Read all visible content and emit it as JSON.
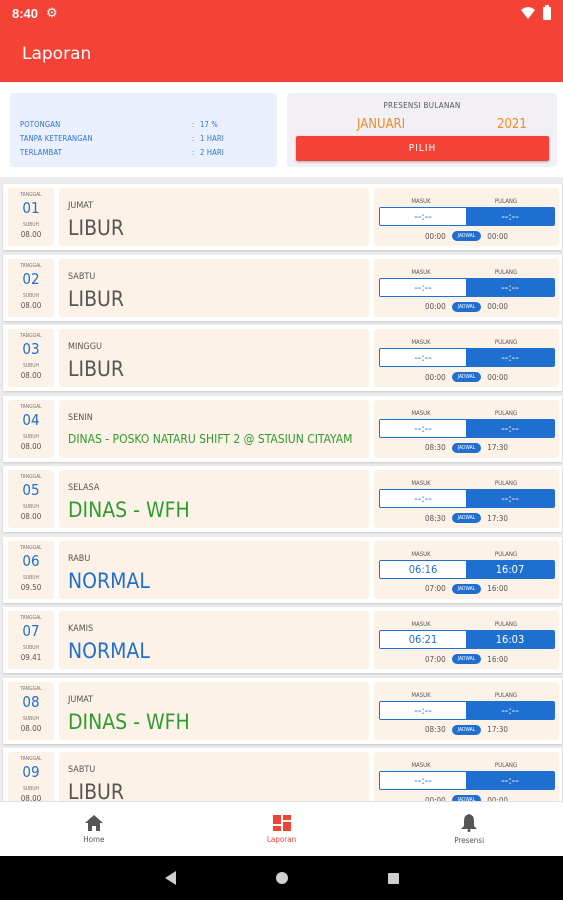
{
  "status_bar": {
    "time": "8:40"
  },
  "app_bar": {
    "title": "Laporan"
  },
  "summary": {
    "items": [
      {
        "label": "POTONGAN",
        "value": "17 %"
      },
      {
        "label": "TANPA KETERANGAN",
        "value": "1 HARI"
      },
      {
        "label": "TERLAMBAT",
        "value": "2 HARI"
      }
    ]
  },
  "period": {
    "title": "PRESENSI BULANAN",
    "month": "JANUARI",
    "year": "2021",
    "button_label": "PILIH"
  },
  "row_labels": {
    "tanggal": "TANGGAL",
    "sebelum": "SUBUH",
    "masuk": "MASUK",
    "pulang": "PULANG",
    "jadwal": "JADWAL"
  },
  "days": [
    {
      "date": "01",
      "subuh": "08.00",
      "day": "JUMAT",
      "status": "LIBUR",
      "status_color": "#555555",
      "in": "--:--",
      "out": "--:--",
      "sched_in": "00:00",
      "sched_out": "00:00"
    },
    {
      "date": "02",
      "subuh": "08.00",
      "day": "SABTU",
      "status": "LIBUR",
      "status_color": "#555555",
      "in": "--:--",
      "out": "--:--",
      "sched_in": "00:00",
      "sched_out": "00:00"
    },
    {
      "date": "03",
      "subuh": "08.00",
      "day": "MINGGU",
      "status": "LIBUR",
      "status_color": "#555555",
      "in": "--:--",
      "out": "--:--",
      "sched_in": "00:00",
      "sched_out": "00:00"
    },
    {
      "date": "04",
      "subuh": "08.00",
      "day": "SENIN",
      "status": "DINAS - POSKO NATARU SHIFT 2 @ STASIUN CITAYAM",
      "status_color": "#2e9c2e",
      "in": "--:--",
      "out": "--:--",
      "sched_in": "08:30",
      "sched_out": "17:30"
    },
    {
      "date": "05",
      "subuh": "08.00",
      "day": "SELASA",
      "status": "DINAS - WFH",
      "status_color": "#2e9c2e",
      "in": "--:--",
      "out": "--:--",
      "sched_in": "08:30",
      "sched_out": "17:30"
    },
    {
      "date": "06",
      "subuh": "09.50",
      "day": "RABU",
      "status": "NORMAL",
      "status_color": "#1f6fd1",
      "in": "06:16",
      "out": "16:07",
      "sched_in": "07:00",
      "sched_out": "16:00"
    },
    {
      "date": "07",
      "subuh": "09.41",
      "day": "KAMIS",
      "status": "NORMAL",
      "status_color": "#1f6fd1",
      "in": "06:21",
      "out": "16:03",
      "sched_in": "07:00",
      "sched_out": "16:00"
    },
    {
      "date": "08",
      "subuh": "08.00",
      "day": "JUMAT",
      "status": "DINAS - WFH",
      "status_color": "#2e9c2e",
      "in": "--:--",
      "out": "--:--",
      "sched_in": "08:30",
      "sched_out": "17:30"
    },
    {
      "date": "09",
      "subuh": "08.00",
      "day": "SABTU",
      "status": "LIBUR",
      "status_color": "#555555",
      "in": "--:--",
      "out": "--:--",
      "sched_in": "00:00",
      "sched_out": "00:00"
    }
  ],
  "bottom_nav": [
    {
      "label": "Home",
      "icon": "home-icon",
      "active": false
    },
    {
      "label": "Laporan",
      "icon": "dashboard-icon",
      "active": true
    },
    {
      "label": "Presensi",
      "icon": "bell-icon",
      "active": false
    }
  ]
}
